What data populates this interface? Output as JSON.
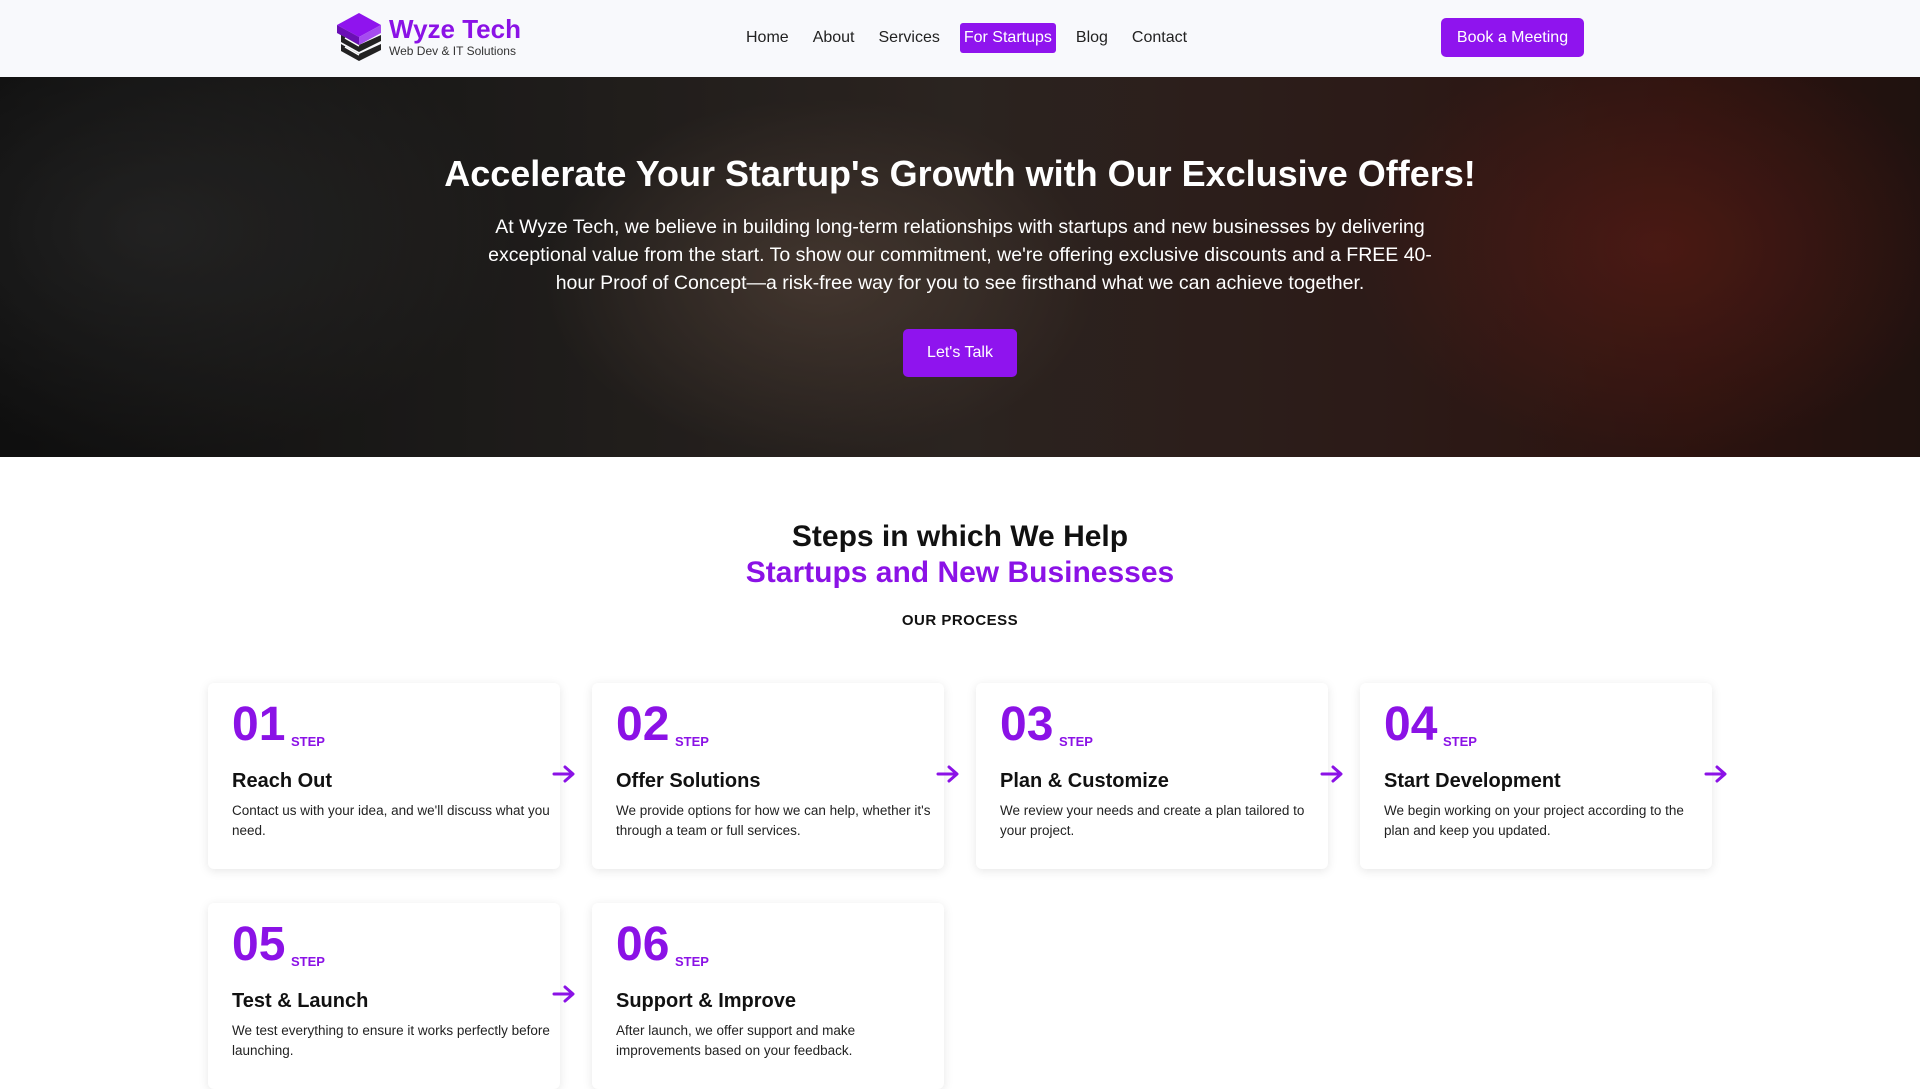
{
  "brand": {
    "name": "Wyze Tech",
    "tagline": "Web Dev & IT Solutions",
    "accent": "#8f14ee"
  },
  "nav": {
    "items": [
      {
        "label": "Home"
      },
      {
        "label": "About"
      },
      {
        "label": "Services"
      },
      {
        "label": "For Startups",
        "active": true
      },
      {
        "label": "Blog"
      },
      {
        "label": "Contact"
      }
    ],
    "cta": "Book a Meeting"
  },
  "hero": {
    "title": "Accelerate Your Startup's Growth with Our Exclusive Offers!",
    "text": "At Wyze Tech, we believe in building long-term relationships with startups and new businesses by delivering exceptional value from the start. To show our commitment, we're offering exclusive discounts and a FREE 40-hour Proof of Concept—a risk-free way for you to see firsthand what we can achieve together.",
    "cta": "Let's Talk"
  },
  "steps": {
    "heading": "Steps in which We Help",
    "subheading": "Startups and New Businesses",
    "eyebrow": "OUR PROCESS",
    "step_word": "STEP",
    "items": [
      {
        "num": "01",
        "title": "Reach Out",
        "desc": "Contact us with your idea, and we'll discuss what you need."
      },
      {
        "num": "02",
        "title": "Offer Solutions",
        "desc": "We provide options for how we can help, whether it's through a team or full services."
      },
      {
        "num": "03",
        "title": "Plan & Customize",
        "desc": "We review your needs and create a plan tailored to your project."
      },
      {
        "num": "04",
        "title": "Start Development",
        "desc": "We begin working on your project according to the plan and keep you updated."
      },
      {
        "num": "05",
        "title": "Test & Launch",
        "desc": "We test everything to ensure it works perfectly before launching."
      },
      {
        "num": "06",
        "title": "Support & Improve",
        "desc": "After launch, we offer support and make improvements based on your feedback."
      }
    ]
  },
  "icons": {
    "logo": "stacked-books-logo-icon",
    "arrow": "arrow-right-icon"
  }
}
